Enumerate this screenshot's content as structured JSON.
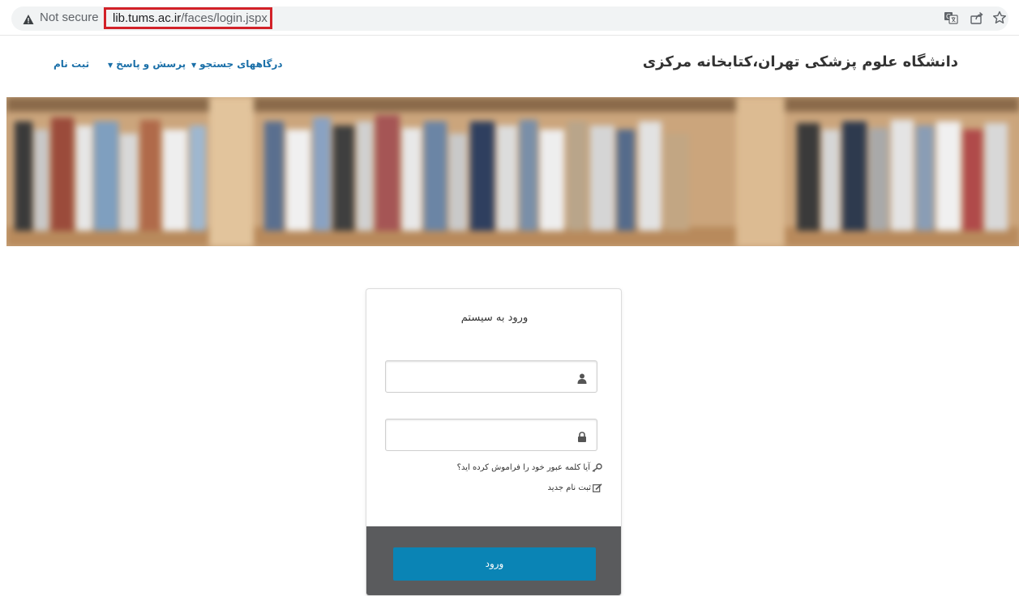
{
  "browser": {
    "security_label": "Not secure",
    "url_host": "lib.tums.ac.ir",
    "url_path": "/faces/login.jspx",
    "highlight_color": "#d22128",
    "icons": [
      "warning-icon",
      "translate-icon",
      "share-icon",
      "bookmark-star-icon"
    ]
  },
  "header": {
    "site_title": "دانشگاه علوم پزشکی تهران،کتابخانه مرکزی",
    "nav": {
      "search_portals": "درگاههای جستجو",
      "qa": "پرسش و پاسخ",
      "register": "ثبت نام"
    },
    "link_color": "#1a6fa8"
  },
  "banner": {
    "image": "blurred-bookshelf"
  },
  "login": {
    "title": "ورود به سیستم",
    "username_placeholder": "",
    "password_placeholder": "",
    "username_icon": "user-icon",
    "password_icon": "lock-icon",
    "forgot_password": "آیا کلمه عبور خود را فراموش کرده اید؟",
    "new_registration": "ثبت نام جدید",
    "submit_label": "ورود",
    "button_color": "#0a84b5",
    "footer_color": "#5a5b5d"
  }
}
